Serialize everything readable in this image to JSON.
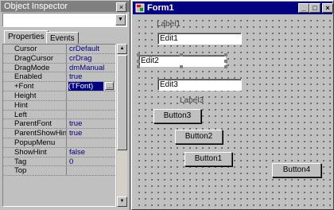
{
  "inspector": {
    "title": "Object Inspector",
    "close": "×",
    "combo_value": "",
    "combo_arrow": "▼",
    "tabs": [
      "Properties",
      "Events"
    ],
    "rows": [
      {
        "name": "Cursor",
        "value": "crDefault"
      },
      {
        "name": "DragCursor",
        "value": "crDrag"
      },
      {
        "name": "DragMode",
        "value": "dmManual"
      },
      {
        "name": "Enabled",
        "value": "true"
      },
      {
        "name": "+Font",
        "value": "(TFont)",
        "selected": true
      },
      {
        "name": "Height",
        "value": ""
      },
      {
        "name": "Hint",
        "value": ""
      },
      {
        "name": "Left",
        "value": ""
      },
      {
        "name": "ParentFont",
        "value": "true"
      },
      {
        "name": "ParentShowHint",
        "value": "true"
      },
      {
        "name": "PopupMenu",
        "value": ""
      },
      {
        "name": "ShowHint",
        "value": "false"
      },
      {
        "name": "Tag",
        "value": "0"
      },
      {
        "name": "Top",
        "value": ""
      }
    ],
    "ellipsis": "...",
    "scroll_up": "▲",
    "scroll_down": "▼"
  },
  "form": {
    "title": "Form1",
    "min": "_",
    "max": "□",
    "close": "×",
    "labels": [
      "Label1",
      "Label3"
    ],
    "edits": [
      "Edit1",
      "Edit2",
      "Edit3"
    ],
    "buttons": [
      "Button3",
      "Button2",
      "Button1",
      "Button4"
    ]
  }
}
